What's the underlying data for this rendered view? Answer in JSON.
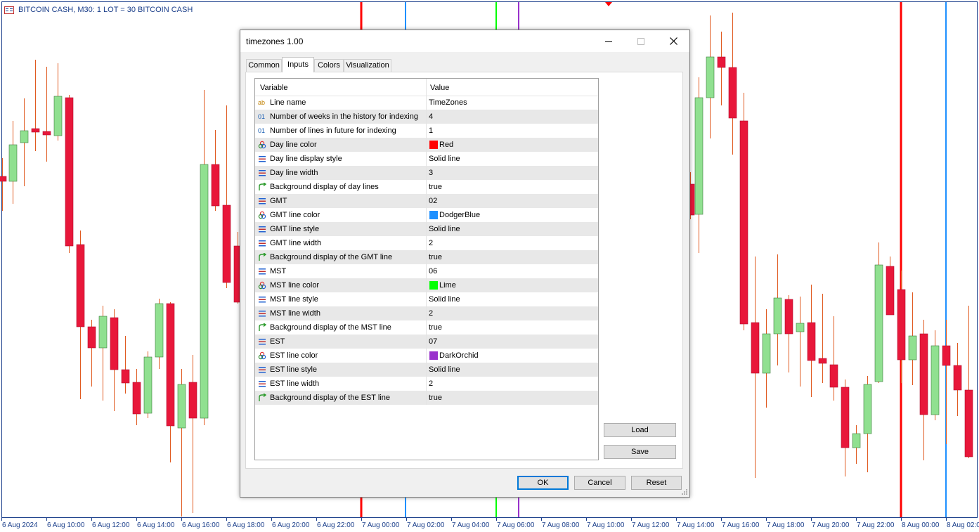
{
  "chart": {
    "title": "BITCOIN CASH, M30:  1 LOT = 30 BITCOIN CASH",
    "x_labels": [
      "6 Aug 2024",
      "6 Aug 10:00",
      "6 Aug 12:00",
      "6 Aug 14:00",
      "6 Aug 16:00",
      "6 Aug 18:00",
      "6 Aug 20:00",
      "6 Aug 22:00",
      "7 Aug 00:00",
      "7 Aug 02:00",
      "7 Aug 04:00",
      "7 Aug 06:00",
      "7 Aug 08:00",
      "7 Aug 10:00",
      "7 Aug 12:00",
      "7 Aug 14:00",
      "7 Aug 16:00",
      "7 Aug 18:00",
      "7 Aug 20:00",
      "7 Aug 22:00",
      "8 Aug 00:00",
      "8 Aug 02:00"
    ],
    "colors": {
      "bull": "#90e090",
      "bear": "#e8173a",
      "wick": "#e05a20",
      "axis": "#1a3e8a",
      "day_line": "#FF0000",
      "gmt_line": "#1E90FF",
      "mst_line": "#00FF00",
      "est_line": "#9932CC"
    }
  },
  "dialog": {
    "title": "timezones 1.00",
    "tabs": [
      "Common",
      "Inputs",
      "Colors",
      "Visualization"
    ],
    "active_tab": "Inputs",
    "columns": {
      "variable": "Variable",
      "value": "Value"
    },
    "rows": [
      {
        "icon": "ab",
        "name": "Line name",
        "value": "TimeZones"
      },
      {
        "icon": "int",
        "name": "Number of weeks in the history for indexing",
        "value": "4"
      },
      {
        "icon": "int",
        "name": "Number of lines in future for indexing",
        "value": "1"
      },
      {
        "icon": "color",
        "name": "Day line color",
        "value": "Red",
        "swatch": "#FF0000"
      },
      {
        "icon": "enum",
        "name": "Day line display style",
        "value": "Solid line"
      },
      {
        "icon": "enum",
        "name": "Day line width",
        "value": "3"
      },
      {
        "icon": "bool",
        "name": "Background display of day lines",
        "value": "true"
      },
      {
        "icon": "enum",
        "name": "GMT",
        "value": "02"
      },
      {
        "icon": "color",
        "name": "GMT line color",
        "value": "DodgerBlue",
        "swatch": "#1E90FF"
      },
      {
        "icon": "enum",
        "name": "GMT line style",
        "value": "Solid line"
      },
      {
        "icon": "enum",
        "name": "GMT line width",
        "value": "2"
      },
      {
        "icon": "bool",
        "name": "Background display of the GMT line",
        "value": "true"
      },
      {
        "icon": "enum",
        "name": "MST",
        "value": "06"
      },
      {
        "icon": "color",
        "name": "MST line color",
        "value": "Lime",
        "swatch": "#00FF00"
      },
      {
        "icon": "enum",
        "name": "MST line style",
        "value": "Solid line"
      },
      {
        "icon": "enum",
        "name": "MST line width",
        "value": "2"
      },
      {
        "icon": "bool",
        "name": "Background display of the MST line",
        "value": "true"
      },
      {
        "icon": "enum",
        "name": "EST",
        "value": "07"
      },
      {
        "icon": "color",
        "name": "EST line color",
        "value": "DarkOrchid",
        "swatch": "#9932CC"
      },
      {
        "icon": "enum",
        "name": "EST line style",
        "value": "Solid line"
      },
      {
        "icon": "enum",
        "name": "EST line width",
        "value": "2"
      },
      {
        "icon": "bool",
        "name": "Background display of the EST line",
        "value": "true"
      }
    ],
    "buttons": {
      "load": "Load",
      "save": "Save",
      "ok": "OK",
      "cancel": "Cancel",
      "reset": "Reset"
    }
  }
}
